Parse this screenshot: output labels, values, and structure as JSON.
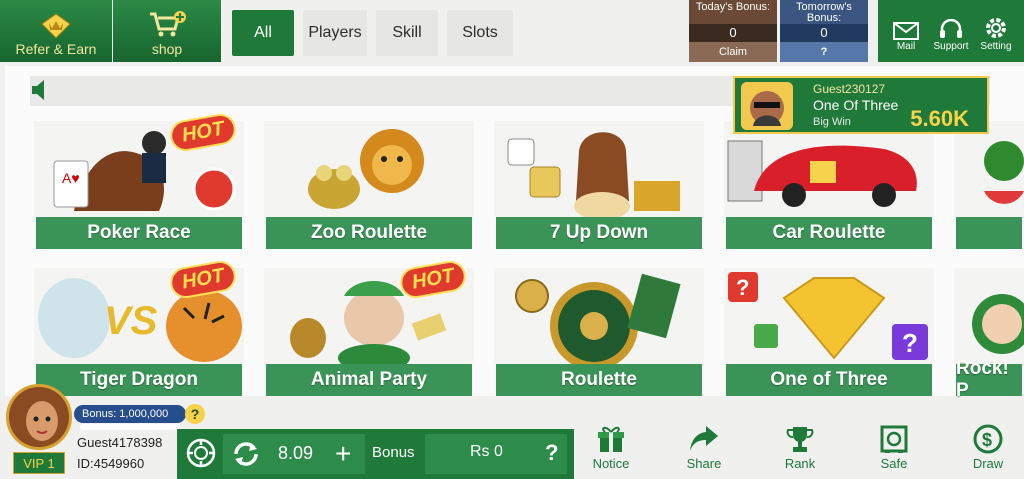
{
  "header": {
    "refer_label": "Refer & Earn",
    "shop_label": "shop",
    "tabs": [
      "All",
      "Players",
      "Skill",
      "Slots"
    ],
    "today_bonus": {
      "title": "Today's Bonus:",
      "value": "0",
      "action": "Claim"
    },
    "tomorrow_bonus": {
      "title": "Tomorrow's Bonus:",
      "value": "0",
      "action": "?"
    },
    "mail_label": "Mail",
    "support_label": "Support",
    "setting_label": "Setting"
  },
  "bigwin": {
    "username": "Guest230127",
    "game": "One Of Three",
    "label": "Big Win",
    "amount": "5.60K"
  },
  "hot_badge": "HOT",
  "games": [
    {
      "name": "Poker Race",
      "icon": "horse-race-icon"
    },
    {
      "name": "Zoo Roulette",
      "icon": "lion-frog-icon"
    },
    {
      "name": "7 Up Down",
      "icon": "dice-icon"
    },
    {
      "name": "Car Roulette",
      "icon": "sports-car-icon"
    },
    {
      "name": "",
      "icon": "fruit-icon"
    },
    {
      "name": "Tiger Dragon",
      "icon": "dragon-tiger-icon"
    },
    {
      "name": "Animal Party",
      "icon": "rabbit-icon"
    },
    {
      "name": "Roulette",
      "icon": "roulette-wheel-icon"
    },
    {
      "name": "One of Three",
      "icon": "diamond-icon"
    },
    {
      "name": "Rock! P",
      "icon": "fist-icon"
    }
  ],
  "player": {
    "bonus": "Bonus: 1,000,000",
    "bonus_help": "?",
    "vip": "VIP 1",
    "username": "Guest4178398",
    "id": "ID:4549960"
  },
  "wallet": {
    "balance": "8.09",
    "plus": "+",
    "bonus_label": "Bonus",
    "bonus_value": "Rs 0",
    "bonus_help": "?"
  },
  "nav": [
    "Notice",
    "Share",
    "Rank",
    "Safe",
    "Draw"
  ],
  "colors": {
    "brand_green": "#1f7a3a",
    "label_green": "#3b9457",
    "gold": "#f6d34a",
    "hot_red": "#e03a2e"
  }
}
